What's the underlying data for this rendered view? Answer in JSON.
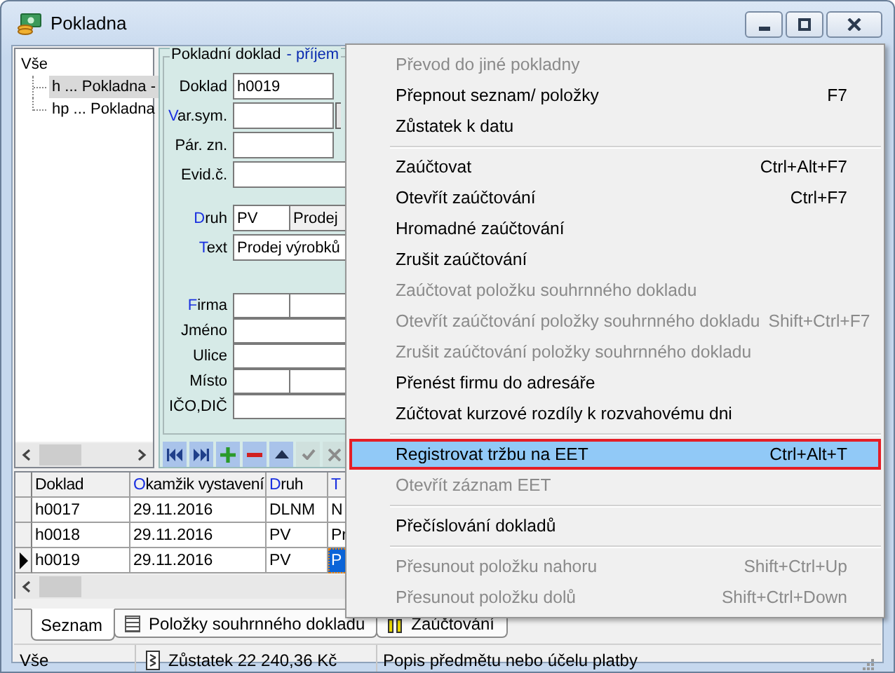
{
  "window": {
    "title": "Pokladna"
  },
  "tree": [
    {
      "label": "Vše",
      "selected": false,
      "children": [
        {
          "label": "h ... Pokladna -",
          "selected": true
        },
        {
          "label": "hp ... Pokladna",
          "selected": false
        }
      ]
    }
  ],
  "form": {
    "group_title": "Pokladní doklad",
    "mode": "- příjem",
    "sections": [
      [
        {
          "label": "Doklad",
          "link": false,
          "kind": "short",
          "values": [
            "h0019"
          ]
        },
        {
          "label": "Var.sym.",
          "link": true,
          "kind": "lookup"
        },
        {
          "label": "Pár. zn.",
          "link": false,
          "kind": "short"
        },
        {
          "label": "Evid.č.",
          "link": false,
          "kind": "long"
        }
      ],
      [
        {
          "label": "Druh",
          "link": true,
          "kind": "split",
          "values": [
            "PV",
            "Prodej"
          ]
        },
        {
          "label": "Text",
          "link": true,
          "kind": "long",
          "values": [
            "Prodej výrobků"
          ]
        }
      ],
      [
        {
          "label": "Firma",
          "link": true,
          "kind": "split"
        },
        {
          "label": "Jméno",
          "link": false,
          "kind": "long"
        },
        {
          "label": "Ulice",
          "link": false,
          "kind": "long"
        },
        {
          "label": "Místo",
          "link": false,
          "kind": "split"
        },
        {
          "label": "IČO,DIČ",
          "link": false,
          "kind": "long"
        }
      ]
    ],
    "navigator": [
      {
        "kind": "first",
        "disabled": false
      },
      {
        "kind": "last",
        "disabled": false
      },
      {
        "kind": "add",
        "disabled": false
      },
      {
        "kind": "delete",
        "disabled": false
      },
      {
        "kind": "up",
        "disabled": false
      },
      {
        "kind": "confirm",
        "disabled": true
      },
      {
        "kind": "cancel",
        "disabled": true
      }
    ]
  },
  "table": {
    "columns": [
      {
        "label": "Doklad",
        "link": false
      },
      {
        "label": "Okamžik vystavení",
        "link": true
      },
      {
        "label": "Druh",
        "link": true
      },
      {
        "label": "T",
        "link": true
      }
    ],
    "rows": [
      {
        "selected": false,
        "cells": [
          "h0017",
          "29.11.2016",
          "DLNM",
          "N"
        ]
      },
      {
        "selected": false,
        "cells": [
          "h0018",
          "29.11.2016",
          "PV",
          "Pr"
        ]
      },
      {
        "selected": true,
        "cells": [
          "h0019",
          "29.11.2016",
          "PV",
          "P"
        ]
      }
    ]
  },
  "tabs": [
    {
      "label": "Seznam",
      "kind": "plain",
      "selected": true
    },
    {
      "label": "Položky souhrnného dokladu",
      "kind": "list",
      "selected": false
    },
    {
      "label": "Zaúčtování",
      "kind": "ledger",
      "selected": false
    }
  ],
  "status_bar": {
    "filter": "Vše",
    "balance": "Zůstatek 22 240,36 Kč",
    "hint": "Popis předmětu nebo účelu platby"
  },
  "context_menu": [
    {
      "kind": "item",
      "label": "Převod do jiné pokladny",
      "disabled": true,
      "selected": false
    },
    {
      "kind": "item",
      "label": "Přepnout seznam/ položky",
      "shortcut": "F7",
      "disabled": false,
      "selected": false
    },
    {
      "kind": "item",
      "label": "Zůstatek k datu",
      "disabled": false,
      "selected": false
    },
    {
      "kind": "separator"
    },
    {
      "kind": "item",
      "label": "Zaúčtovat",
      "shortcut": "Ctrl+Alt+F7",
      "disabled": false,
      "selected": false
    },
    {
      "kind": "item",
      "label": "Otevřít zaúčtování",
      "shortcut": "Ctrl+F7",
      "disabled": false,
      "selected": false
    },
    {
      "kind": "item",
      "label": "Hromadné zaúčtování",
      "disabled": false,
      "selected": false
    },
    {
      "kind": "item",
      "label": "Zrušit zaúčtování",
      "disabled": false,
      "selected": false
    },
    {
      "kind": "item",
      "label": "Zaúčtovat položku souhrnného dokladu",
      "disabled": true,
      "selected": false
    },
    {
      "kind": "item",
      "label": "Otevřít zaúčtování položky souhrnného dokladu",
      "shortcut": "Shift+Ctrl+F7",
      "disabled": true,
      "selected": false
    },
    {
      "kind": "item",
      "label": "Zrušit zaúčtování položky souhrnného dokladu",
      "disabled": true,
      "selected": false
    },
    {
      "kind": "item",
      "label": "Přenést firmu do adresáře",
      "disabled": false,
      "selected": false
    },
    {
      "kind": "item",
      "label": "Zúčtovat kurzové rozdíly k rozvahovému dni",
      "disabled": false,
      "selected": false
    },
    {
      "kind": "separator"
    },
    {
      "kind": "item",
      "label": "Registrovat tržbu na EET",
      "shortcut": "Ctrl+Alt+T",
      "disabled": false,
      "selected": true
    },
    {
      "kind": "item",
      "label": "Otevřít záznam EET",
      "disabled": true,
      "selected": false
    },
    {
      "kind": "separator"
    },
    {
      "kind": "item",
      "label": "Přečíslování dokladů",
      "disabled": false,
      "selected": false
    },
    {
      "kind": "separator"
    },
    {
      "kind": "item",
      "label": "Přesunout položku nahoru",
      "shortcut": "Shift+Ctrl+Up",
      "disabled": true,
      "selected": false
    },
    {
      "kind": "item",
      "label": "Přesunout položku dolů",
      "shortcut": "Shift+Ctrl+Down",
      "disabled": true,
      "selected": false
    }
  ]
}
